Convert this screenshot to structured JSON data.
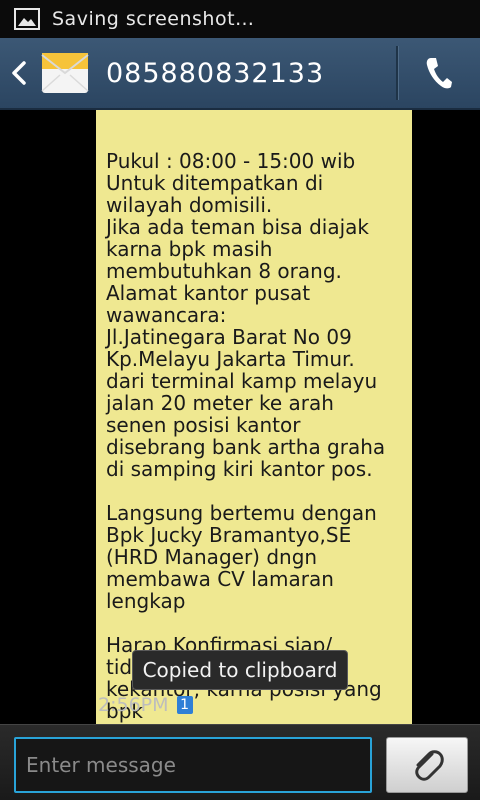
{
  "status_bar": {
    "notification_text": "Saving screenshot…",
    "icon": "image-icon"
  },
  "action_bar": {
    "contact_number": "085880832133",
    "icons": [
      "back-chevron-icon",
      "envelope-icon",
      "phone-icon"
    ]
  },
  "conversation": {
    "message_text": "Pukul : 08:00 - 15:00 wib\nUntuk ditempatkan di\nwilayah domisili.\nJika ada teman bisa diajak\nkarna bpk masih\nmembutuhkan 8 orang.\nAlamat kantor pusat\nwawancara:\nJl.Jatinegara Barat No 09\nKp.Melayu Jakarta Timur.\ndari terminal kamp melayu\njalan 20 meter ke arah\nsenen posisi kantor\ndisebrang bank artha graha\ndi samping kiri kantor pos.\n\nLangsung bertemu dengan\nBpk Jucky Bramantyo,SE\n(HRD Manager) dngn\nmembawa CV lamaran\nlengkap\n\nHarap Konfirmasi siap/\ntidaknya untuk datang\nkekantor, karna posisi yang\nbpk",
    "timestamp": "2:56PM",
    "sim_badge": "1",
    "toast": "Copied to clipboard"
  },
  "compose": {
    "placeholder": "Enter message",
    "value": ""
  },
  "colors": {
    "bubble": "#efe891",
    "action_bar": "#34506d",
    "input_border": "#29a3d8"
  }
}
